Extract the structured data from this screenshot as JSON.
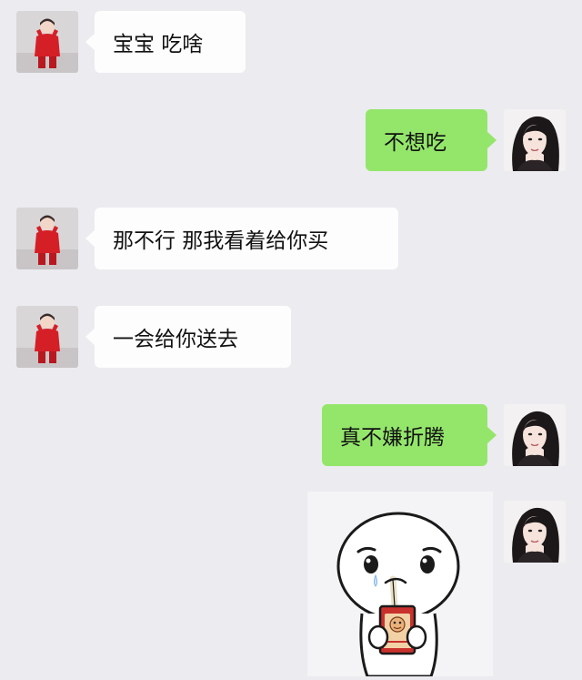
{
  "chat": {
    "messages": [
      {
        "side": "left",
        "text": "宝宝 吃啥"
      },
      {
        "side": "right",
        "text": "不想吃"
      },
      {
        "side": "left",
        "text": "那不行 那我看着给你买"
      },
      {
        "side": "left",
        "text": "一会给你送去"
      },
      {
        "side": "right",
        "text": "真不嫌折腾"
      },
      {
        "side": "right",
        "sticker": "crying-drink-sticker"
      }
    ]
  },
  "colors": {
    "background": "#ecebef",
    "incoming_bubble": "#fdfdfd",
    "outgoing_bubble": "#94e66b"
  },
  "icons": {
    "left_avatar": "girl-red-outfit-avatar",
    "right_avatar": "woman-long-hair-avatar",
    "sticker": "crying-drink-sticker"
  }
}
